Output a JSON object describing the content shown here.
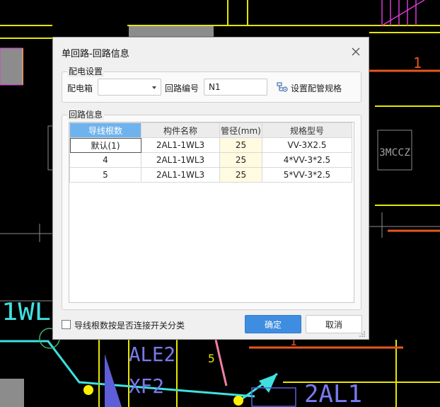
{
  "dialog": {
    "title": "单回路-回路信息",
    "close_icon": "close-icon"
  },
  "distribution": {
    "group_label": "配电设置",
    "box_label": "配电箱",
    "box_value": "",
    "circuit_label": "回路编号",
    "circuit_value": "N1",
    "conduit_spec_label": "设置配管规格",
    "conduit_spec_icon": "conduit-spec-icon"
  },
  "circuit_info": {
    "group_label": "回路信息",
    "columns": [
      "导线根数",
      "构件名称",
      "管径(mm)",
      "规格型号"
    ],
    "rows": [
      [
        "默认(1)",
        "2AL1-1WL3",
        "25",
        "VV-3X2.5"
      ],
      [
        "4",
        "2AL1-1WL3",
        "25",
        "4*VV-3*2.5"
      ],
      [
        "5",
        "2AL1-1WL3",
        "25",
        "5*VV-3*2.5"
      ]
    ]
  },
  "footer": {
    "checkbox_label": "导线根数按是否连接开关分类",
    "checkbox_checked": false,
    "ok_label": "确定",
    "cancel_label": "取消"
  },
  "background": {
    "labels": {
      "wl": "1WL",
      "ale": "ALE2",
      "xf": "XF2",
      "al": "2AL1",
      "num1": "1",
      "num1b": "1",
      "num5": "5",
      "tag": "3MCCZ"
    }
  },
  "colors": {
    "accent": "#3f8de0",
    "header_active": "#6fb3ee",
    "highlight_cell": "#fffbe1",
    "cad_yellow": "#e6e600",
    "cad_orange": "#e8571e",
    "cad_cyan": "#3fe0e0",
    "cad_magenta": "#d838d8"
  }
}
